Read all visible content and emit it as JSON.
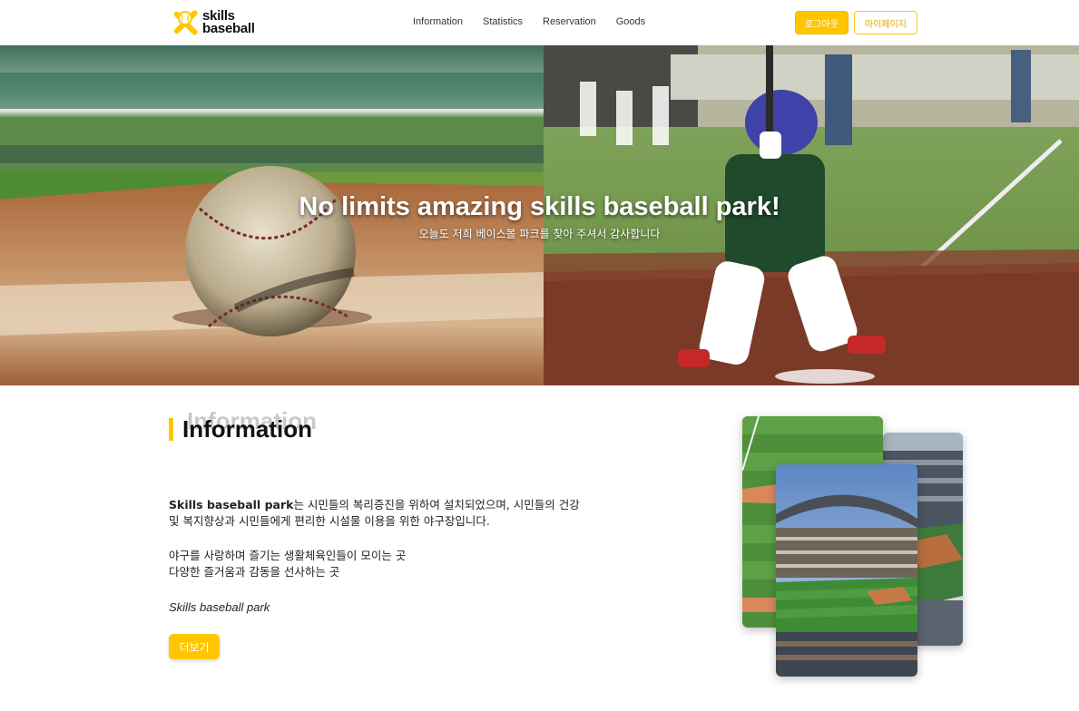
{
  "header": {
    "logo_line1": "skills",
    "logo_line2": "baseball",
    "nav": [
      "Information",
      "Statistics",
      "Reservation",
      "Goods"
    ],
    "logout_label": "로그아웃",
    "mypage_label": "마이페이지"
  },
  "hero": {
    "title": "No limits amazing skills baseball park!",
    "subtitle": "오늘도 저희 베이스볼 파크를 찾아 주셔서 감사합니다"
  },
  "info": {
    "ghost_title": "Information",
    "title": "Information",
    "p1_strong": "Skills baseball park",
    "p1_rest": "는 시민들의 복리증진을 위하여 설치되었으며, 시민들의 건강 및 복지향상과 시민들에게 편리한 시설물 이용을 위한 야구장입니다.",
    "p2_line1": "야구를 사랑하며 즐기는 생활체육인들이 모이는 곳",
    "p2_line2": "다양한 즐거움과 감동을 선사하는 곳",
    "p3": "Skills baseball park",
    "more_label": "더보기"
  },
  "colors": {
    "accent": "#ffc600"
  },
  "icons": {
    "logo": "crossed-bats-baseball-icon"
  }
}
